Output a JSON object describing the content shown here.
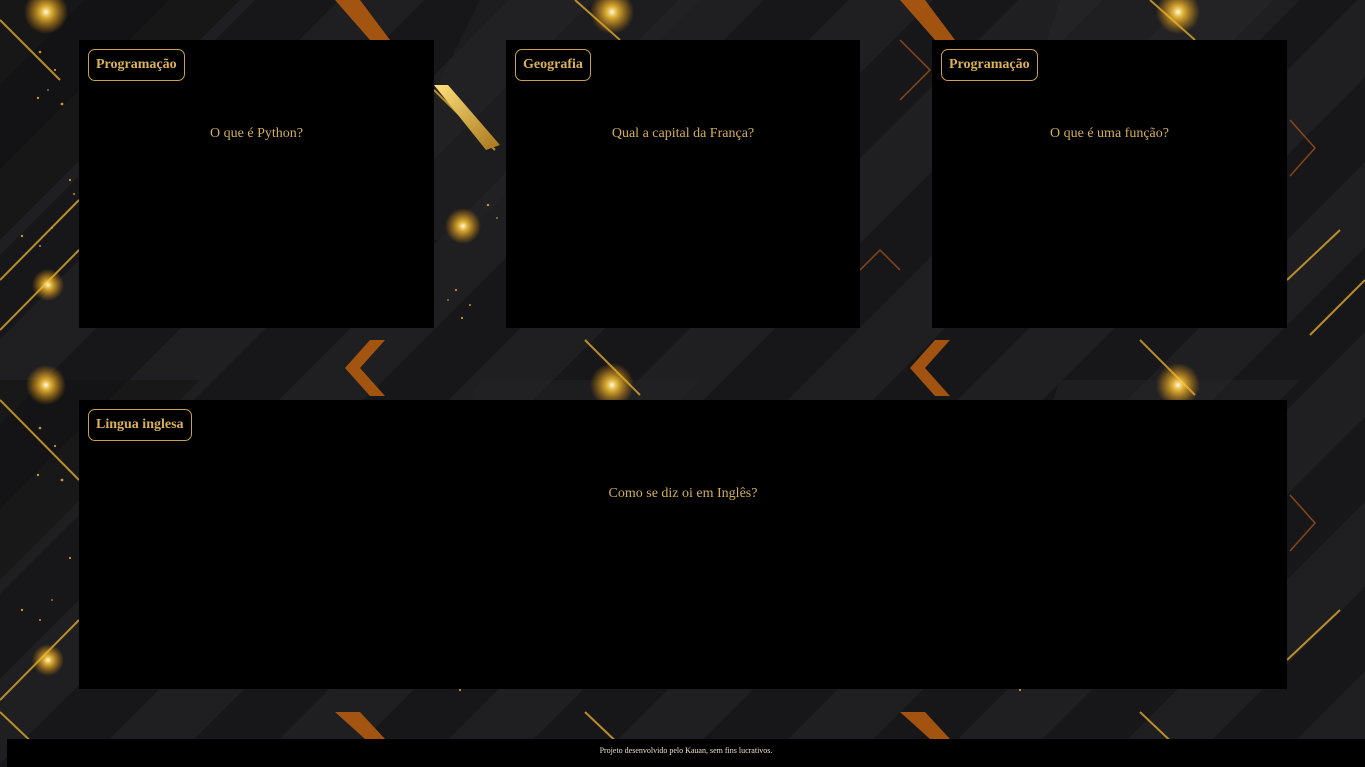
{
  "colors": {
    "accent": "#d4ae5a",
    "chip_border": "#c8a24a",
    "card_background": "#000000",
    "glow": "#ffc93a",
    "copper": "#b35a10"
  },
  "cards": [
    {
      "category": "Programação",
      "question": "O que é Python?"
    },
    {
      "category": "Geografia",
      "question": "Qual a capital da França?"
    },
    {
      "category": "Programação",
      "question": "O que é uma função?"
    },
    {
      "category": "Lingua inglesa",
      "question": "Como se diz oi em Inglês?"
    }
  ],
  "footer": {
    "text": "Projeto desenvolvido pelo Kauan, sem fins lucrativos."
  }
}
